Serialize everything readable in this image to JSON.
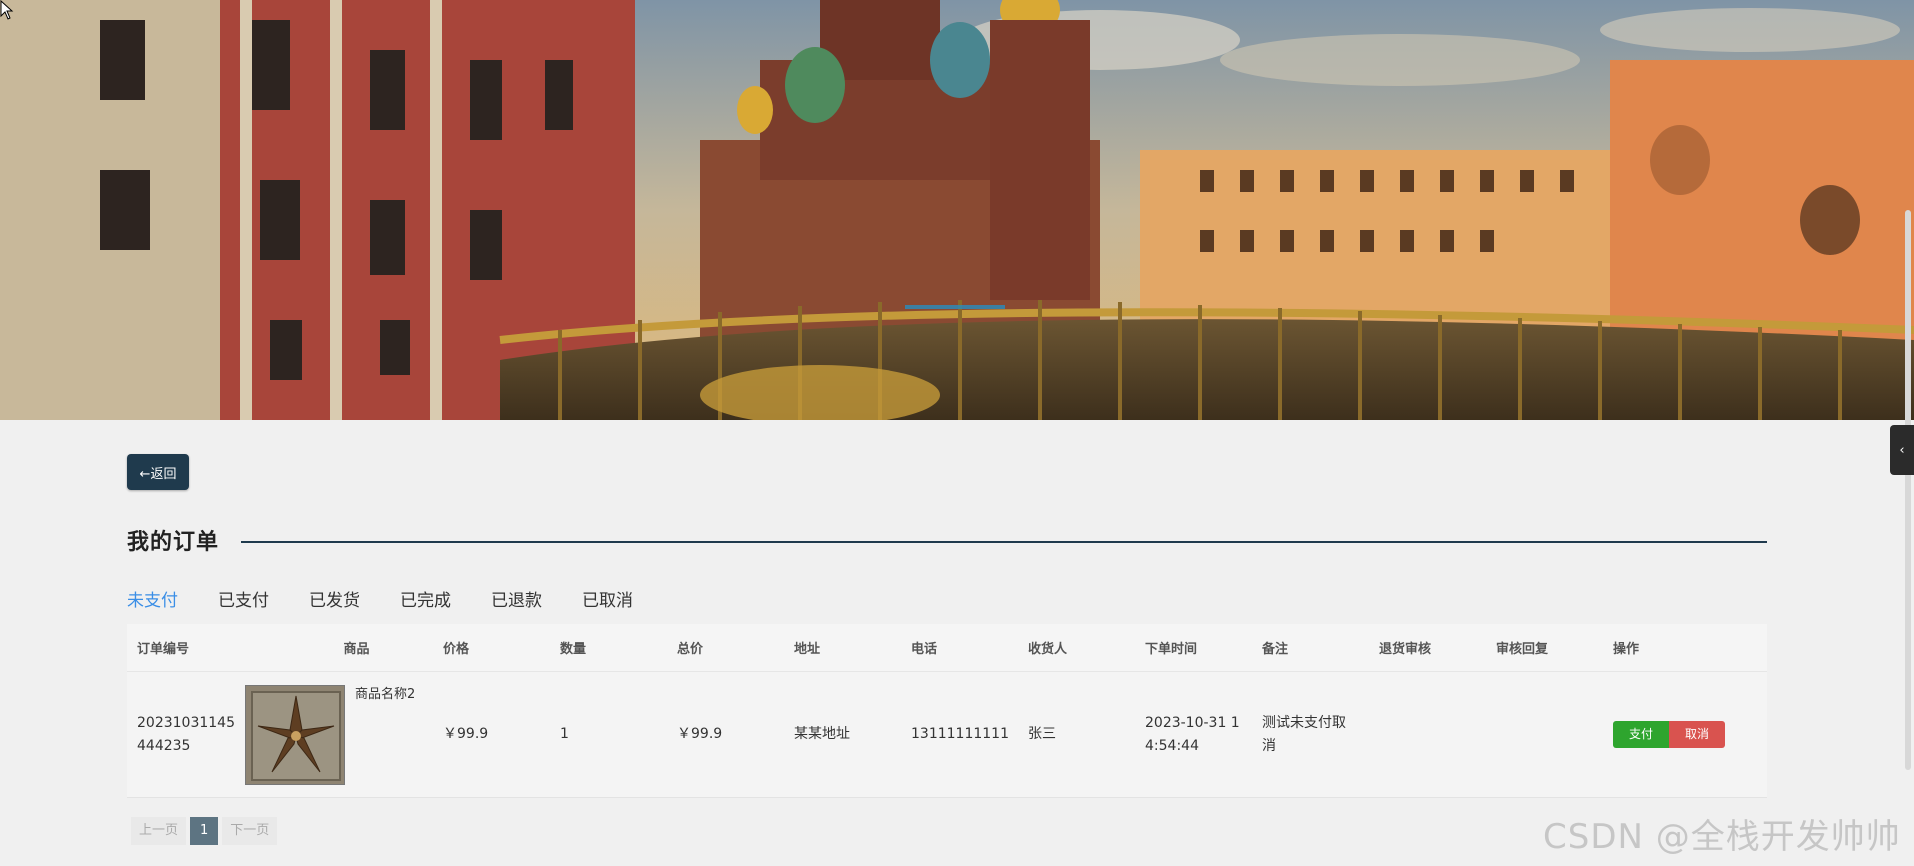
{
  "banner": {
    "alt": ""
  },
  "back_button": {
    "label": "←返回"
  },
  "page_title": "我的订单",
  "tabs": [
    {
      "label": "未支付",
      "active": true
    },
    {
      "label": "已支付",
      "active": false
    },
    {
      "label": "已发货",
      "active": false
    },
    {
      "label": "已完成",
      "active": false
    },
    {
      "label": "已退款",
      "active": false
    },
    {
      "label": "已取消",
      "active": false
    }
  ],
  "table": {
    "columns": [
      "订单编号",
      "商品",
      "价格",
      "数量",
      "总价",
      "地址",
      "电话",
      "收货人",
      "下单时间",
      "备注",
      "退货审核",
      "审核回复",
      "操作"
    ],
    "rows": [
      {
        "order_no": "20231031145\n444235",
        "product_name": "商品名称2",
        "price": "￥99.9",
        "quantity": "1",
        "total": "￥99.9",
        "address": "某某地址",
        "phone": "13111111111",
        "receiver": "张三",
        "order_time": "2023-10-31 1\n4:54:44",
        "remark": "测试未支付取\n消",
        "return_review": "",
        "review_reply": "",
        "pay_label": "支付",
        "cancel_label": "取消"
      }
    ]
  },
  "pagination": {
    "prev": "上一页",
    "current": "1",
    "next": "下一页"
  },
  "side_tab": {
    "icon": "chevron-left-icon",
    "label": "‹"
  },
  "watermark": "CSDN @全栈开发帅帅",
  "colors": {
    "accent": "#3a8ee6",
    "dark": "#1f3a4d",
    "pay": "#2ea52e",
    "cancel": "#d9534f"
  }
}
